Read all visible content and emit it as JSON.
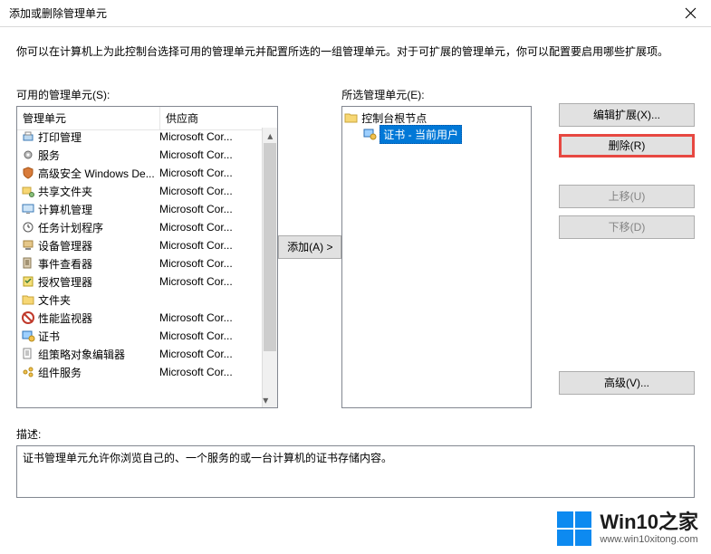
{
  "titlebar": {
    "title": "添加或删除管理单元"
  },
  "intro": "你可以在计算机上为此控制台选择可用的管理单元并配置所选的一组管理单元。对于可扩展的管理单元，你可以配置要启用哪些扩展项。",
  "left": {
    "label": "可用的管理单元(S):",
    "header_name": "管理单元",
    "header_vendor": "供应商",
    "items": [
      {
        "name": "打印管理",
        "vendor": "Microsoft Cor...",
        "icon": "printer"
      },
      {
        "name": "服务",
        "vendor": "Microsoft Cor...",
        "icon": "gear"
      },
      {
        "name": "高级安全 Windows De...",
        "vendor": "Microsoft Cor...",
        "icon": "shield"
      },
      {
        "name": "共享文件夹",
        "vendor": "Microsoft Cor...",
        "icon": "share"
      },
      {
        "name": "计算机管理",
        "vendor": "Microsoft Cor...",
        "icon": "computer"
      },
      {
        "name": "任务计划程序",
        "vendor": "Microsoft Cor...",
        "icon": "clock"
      },
      {
        "name": "设备管理器",
        "vendor": "Microsoft Cor...",
        "icon": "device"
      },
      {
        "name": "事件查看器",
        "vendor": "Microsoft Cor...",
        "icon": "event"
      },
      {
        "name": "授权管理器",
        "vendor": "Microsoft Cor...",
        "icon": "auth"
      },
      {
        "name": "文件夹",
        "vendor": "",
        "icon": "folder"
      },
      {
        "name": "性能监视器",
        "vendor": "Microsoft Cor...",
        "icon": "perf"
      },
      {
        "name": "证书",
        "vendor": "Microsoft Cor...",
        "icon": "cert"
      },
      {
        "name": "组策略对象编辑器",
        "vendor": "Microsoft Cor...",
        "icon": "policy"
      },
      {
        "name": "组件服务",
        "vendor": "Microsoft Cor...",
        "icon": "comp"
      }
    ]
  },
  "middle": {
    "add": "添加(A) >"
  },
  "right": {
    "label": "所选管理单元(E):",
    "root": "控制台根节点",
    "child": "证书 - 当前用户"
  },
  "buttons": {
    "edit_ext": "编辑扩展(X)...",
    "remove": "删除(R)",
    "move_up": "上移(U)",
    "move_down": "下移(D)",
    "advanced": "高级(V)..."
  },
  "desc_label": "描述:",
  "desc_text": "证书管理单元允许你浏览自己的、一个服务的或一台计算机的证书存储内容。",
  "watermark": {
    "big": "Win10之家",
    "small": "www.win10xitong.com"
  }
}
